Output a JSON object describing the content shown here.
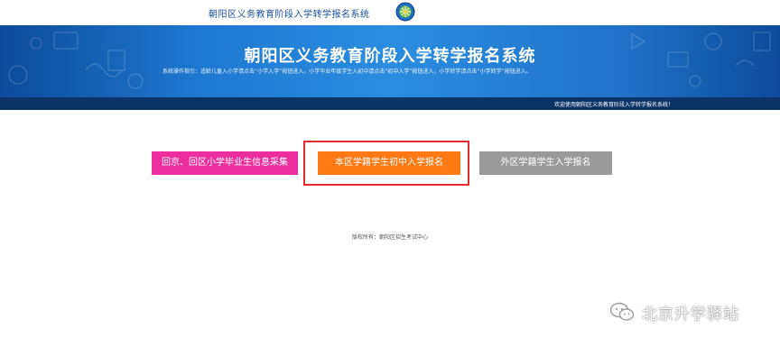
{
  "header": {
    "small_title": "朝阳区义务教育阶段入学转学报名系统",
    "emblem_icon": "government-emblem-icon"
  },
  "banner": {
    "title": "朝阳区义务教育阶段入学转学报名系统",
    "guide": "系统操作指引：适龄儿童入小学请点击“小学入学”按钮进入，小学毕业年级学生入初中请点击“初中入学”按钮进入，小学转学请点击“小学转学”按钮进入。",
    "welcome": "欢迎使用朝阳区义务教育阶段入学转学报名系统！"
  },
  "buttons": {
    "return_label": "回京、回区小学毕业生信息采集",
    "local_label": "本区学籍学生初中入学报名",
    "outside_label": "外区学籍学生入学报名"
  },
  "colors": {
    "pink": "#ec2f9e",
    "orange": "#ff7a14",
    "gray": "#9a9a9a",
    "highlight": "#e42b2b",
    "banner_blue": "#1d78cf"
  },
  "footer": {
    "copyright": "版权所有：朝阳区招生考试中心"
  },
  "watermark": {
    "icon": "wechat-icon",
    "text": "北京升学驿站"
  }
}
